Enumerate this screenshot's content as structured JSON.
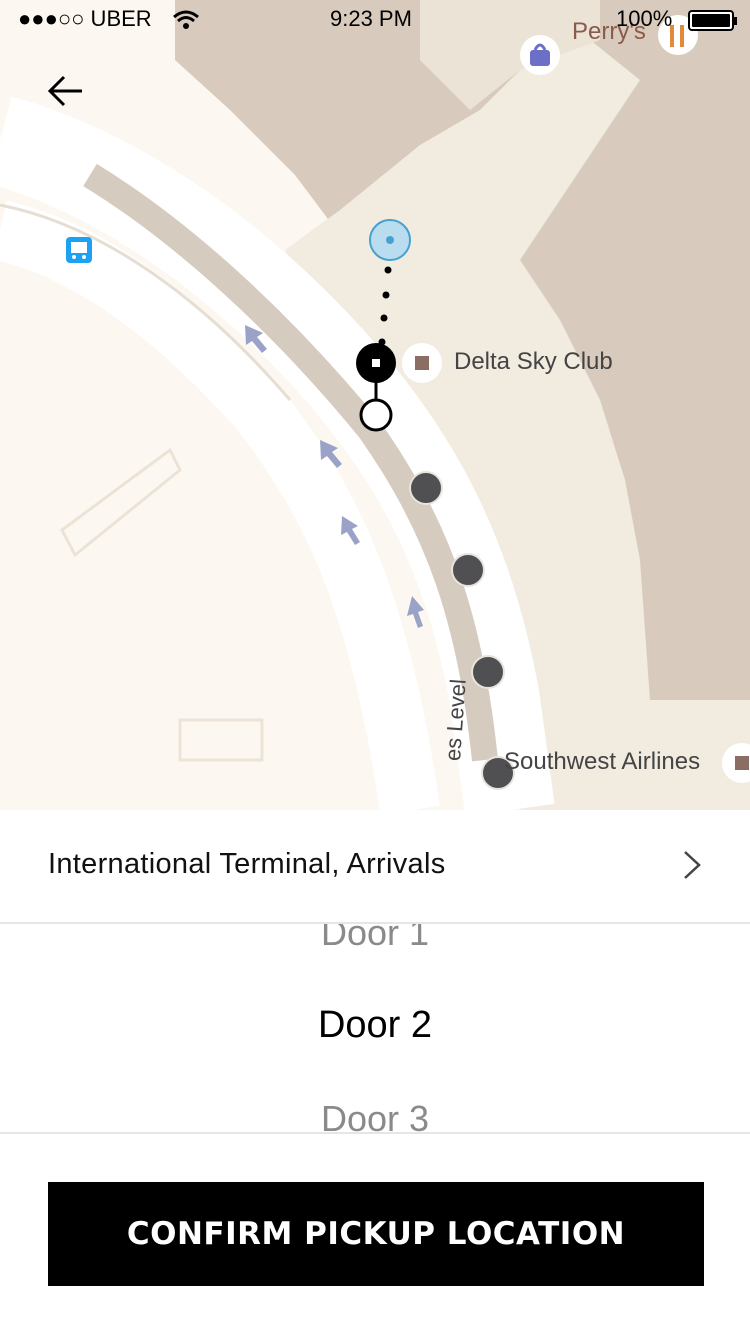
{
  "status_bar": {
    "carrier": "●●●○○ UBER",
    "time": "9:23 PM",
    "battery": "100%"
  },
  "map": {
    "labels": {
      "delta": "Delta Sky Club",
      "southwest": "Southwest Airlines",
      "perrys": "Perry's",
      "road": "es Level"
    },
    "icons": [
      "back-arrow-icon",
      "bus-stop-icon",
      "shopping-bag-icon",
      "restaurant-icon",
      "user-location-icon",
      "pickup-pin-icon"
    ],
    "colors": {
      "terminal_building": "#d8cbbd",
      "road": "#ffffff",
      "user_location": "#47a1cf",
      "door_marker": "#505053",
      "pin": "#000000"
    }
  },
  "terminal": {
    "label": "International Terminal, Arrivals"
  },
  "picker": {
    "options": [
      "Door 1",
      "Door 2",
      "Door 3"
    ],
    "selected": "Door 2"
  },
  "confirm_button": {
    "label": "CONFIRM PICKUP LOCATION"
  }
}
